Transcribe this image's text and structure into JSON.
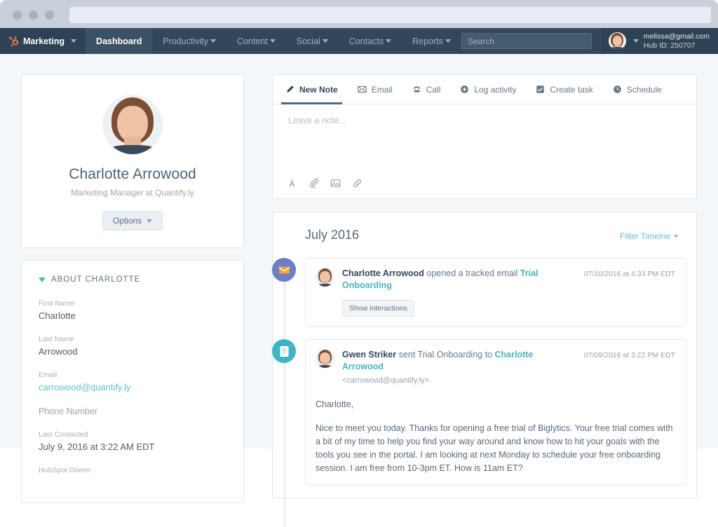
{
  "browser": {
    "address_value": "",
    "address_placeholder": ""
  },
  "navbar": {
    "brand": "Marketing",
    "items": [
      {
        "label": "Dashboard",
        "active": true,
        "caret": false
      },
      {
        "label": "Productivity",
        "active": false,
        "caret": true
      },
      {
        "label": "Content",
        "active": false,
        "caret": true
      },
      {
        "label": "Social",
        "active": false,
        "caret": true
      },
      {
        "label": "Contacts",
        "active": false,
        "caret": true
      },
      {
        "label": "Reports",
        "active": false,
        "caret": true
      }
    ],
    "search_placeholder": "Search",
    "search_value": "",
    "user_email": "melissa@gmail.com",
    "hub_id": "Hub ID: 250707"
  },
  "profile": {
    "name": "Charlotte Arrowood",
    "subtitle": "Marketing Manager at Quantify.ly",
    "options_label": "Options"
  },
  "about": {
    "heading": "ABOUT CHARLOTTE",
    "fields": [
      {
        "label": "First Name",
        "value": "Charlotte",
        "style": "plain"
      },
      {
        "label": "Last Name",
        "value": "Arrowood",
        "style": "plain"
      },
      {
        "label": "Email",
        "value": "carrowood@quantify.ly",
        "style": "link"
      },
      {
        "label": "Phone Number",
        "value": "",
        "style": "empty"
      },
      {
        "label": "Last Contacted",
        "value": "July 9, 2016 at 3:22 AM EDT",
        "style": "plain"
      },
      {
        "label": "HubSpot Owner",
        "value": "",
        "style": "cut"
      }
    ]
  },
  "composer": {
    "tabs": [
      {
        "label": "New Note",
        "icon": "pencil-icon",
        "active": true
      },
      {
        "label": "Email",
        "icon": "envelope-icon",
        "active": false
      },
      {
        "label": "Call",
        "icon": "phone-icon",
        "active": false
      },
      {
        "label": "Log activity",
        "icon": "plus-circle-icon",
        "active": false
      },
      {
        "label": "Create task",
        "icon": "checkbox-icon",
        "active": false
      },
      {
        "label": "Schedule",
        "icon": "clock-icon",
        "active": false
      }
    ],
    "placeholder": "Leave a note...",
    "value": "",
    "tools": [
      "font-icon",
      "paperclip-icon",
      "image-icon",
      "link-icon"
    ]
  },
  "timeline": {
    "month": "July 2016",
    "filter_label": "Filter Timelne",
    "entries": [
      {
        "bullet": "email-open-icon",
        "actor": "Charlotte Arrowood",
        "action": " opened a tracked email ",
        "subject": "Trial Onboarding",
        "date": "07/10/2016 at 4:33 PM EDT",
        "button": "Show interactions"
      },
      {
        "bullet": "document-icon",
        "actor": "Gwen Striker",
        "action": " sent Trial Onboarding to ",
        "subject": "Charlotte Arrowood",
        "recipient": "<carrowood@quantify.ly>",
        "date": "07/09/2016 at 3:22 PM EDT",
        "message_greeting": "Charlotte,",
        "message_body": "Nice to meet you today.  Thanks for opening a free trial of Biglytics.  Your free trial comes with a bit of my time to help you find your way around and know how to hit your goals with the tools you see in the portal.  I am looking at next Monday to schedule your free onboarding session.  I am free from 10-3pm ET. How is 11am ET?"
      }
    ]
  },
  "colors": {
    "nav_bg": "#33475b",
    "accent_teal": "#63c0c7",
    "brand_orange": "#f2764b",
    "bullet_email": "#6a7fc4",
    "bullet_doc": "#3fb5c4"
  }
}
